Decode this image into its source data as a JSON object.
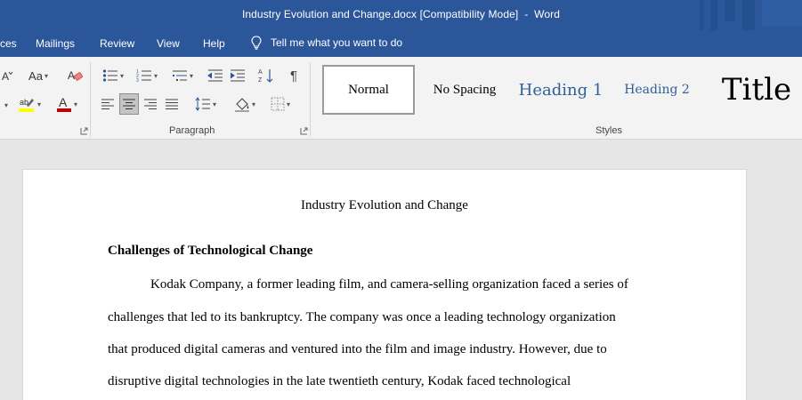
{
  "window": {
    "doc_name": "Industry Evolution and Change.docx",
    "mode": "[Compatibility Mode]",
    "separator": "-",
    "app": "Word"
  },
  "menu": {
    "tabs": [
      "ces",
      "Mailings",
      "Review",
      "View",
      "Help"
    ],
    "tell_me": "Tell me what you want to do"
  },
  "ribbon": {
    "font_labels": {
      "change_case": "Aa"
    },
    "groups": {
      "paragraph": "Paragraph",
      "styles": "Styles"
    },
    "styles": [
      "Normal",
      "No Spacing",
      "Heading 1",
      "Heading 2",
      "Title"
    ],
    "selected_style": "Normal",
    "active_alignment": "center"
  },
  "document": {
    "title": "Industry Evolution and Change",
    "heading": "Challenges of Technological Change",
    "lines": [
      "Kodak Company, a former leading film, and camera-selling organization faced a series of",
      "challenges that led to its bankruptcy. The company was once a leading technology organization",
      "that produced digital cameras and ventured into the film and image industry. However, due to",
      "disruptive digital technologies in the late twentieth century, Kodak faced technological"
    ]
  },
  "colors": {
    "title_bar": "#2b579a",
    "ribbon_bg": "#f3f3f3",
    "heading_style": "#2e5f99",
    "highlight": "#ffff00",
    "font_color": "#c00000"
  }
}
